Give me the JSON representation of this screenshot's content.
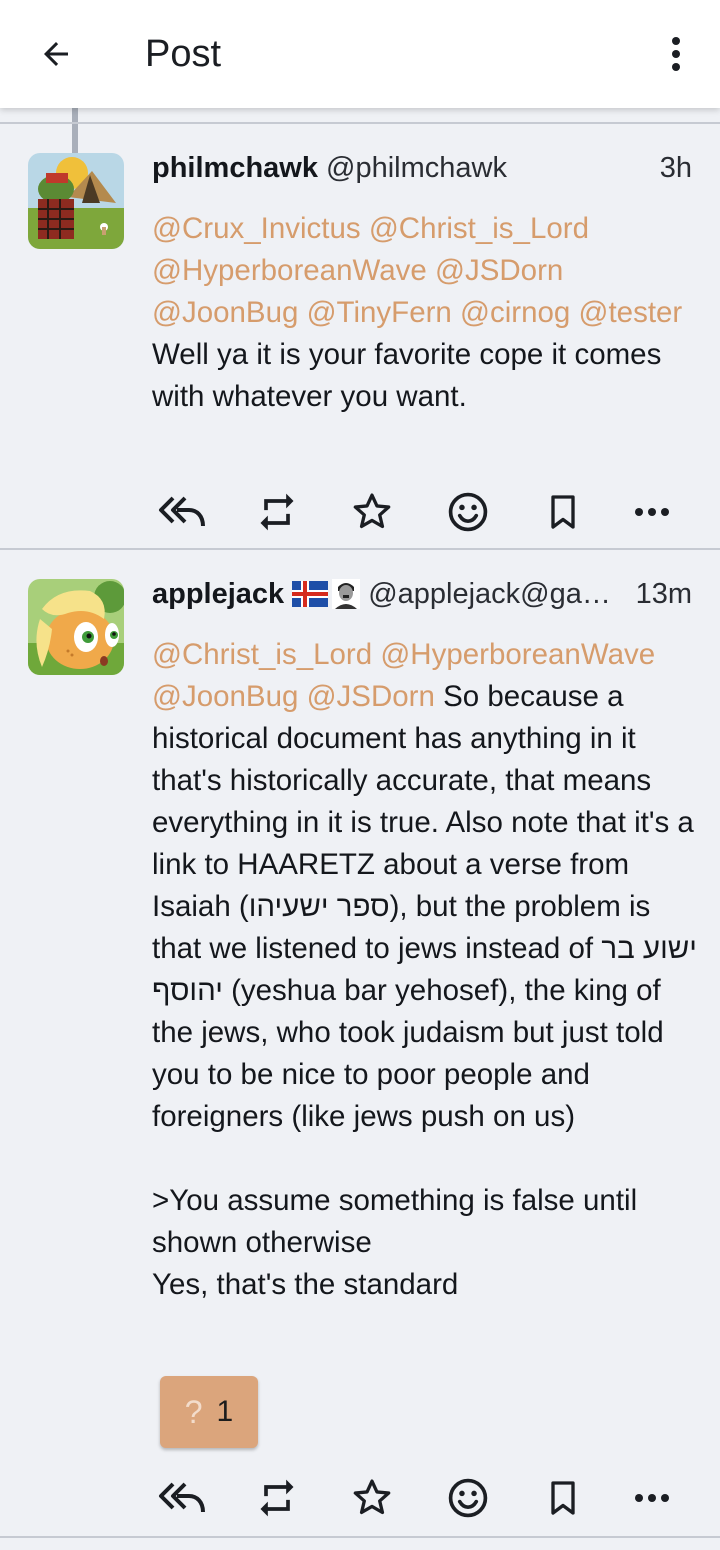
{
  "appbar": {
    "title": "Post",
    "back_icon": "arrow-left-icon",
    "menu_icon": "more-vertical-icon"
  },
  "colors": {
    "mention": "#d69c6c",
    "background": "#eff1f5",
    "reaction_bg": "#dba57c"
  },
  "posts": [
    {
      "display_name": "philmchawk",
      "handle": "@philmchawk",
      "time": "3h",
      "avatar": "frog-camping-avatar",
      "mentions": "@Crux_Invictus @Christ_is_Lord @HyperboreanWave @JSDorn @JoonBug @TinyFern @cirnog @tester",
      "text": "Well ya it is your favorite cope it comes with whatever you want.",
      "actions": [
        "reply-all-icon",
        "repeat-icon",
        "star-icon",
        "emoji-icon",
        "bookmark-icon",
        "more-horizontal-icon"
      ]
    },
    {
      "display_name": "applejack",
      "handle": "@applejack@ga…",
      "time": "13m",
      "avatar": "pony-avatar",
      "emojis": [
        "iceland-flag-emoji",
        "person-emoji"
      ],
      "mentions": "@Christ_is_Lord @HyperboreanWave @JoonBug @JSDorn",
      "text": " So because a historical document has anything in it that's historically accurate, that means everything in it is true. Also note that it's a link to HAARETZ about a verse from Isaiah (ספר ישעיהו), but the problem is that we listened to jews instead of ישוע בר יהוסף (yeshua bar yehosef), the king of the jews, who took judaism but just told you to be nice to poor people and foreigners (like jews push on us)\n\n>You assume something is false until shown otherwise\nYes, that's the standard",
      "reaction": {
        "emoji": "?",
        "count": "1"
      },
      "actions": [
        "reply-all-icon",
        "repeat-icon",
        "star-icon",
        "emoji-icon",
        "bookmark-icon",
        "more-horizontal-icon"
      ]
    }
  ]
}
